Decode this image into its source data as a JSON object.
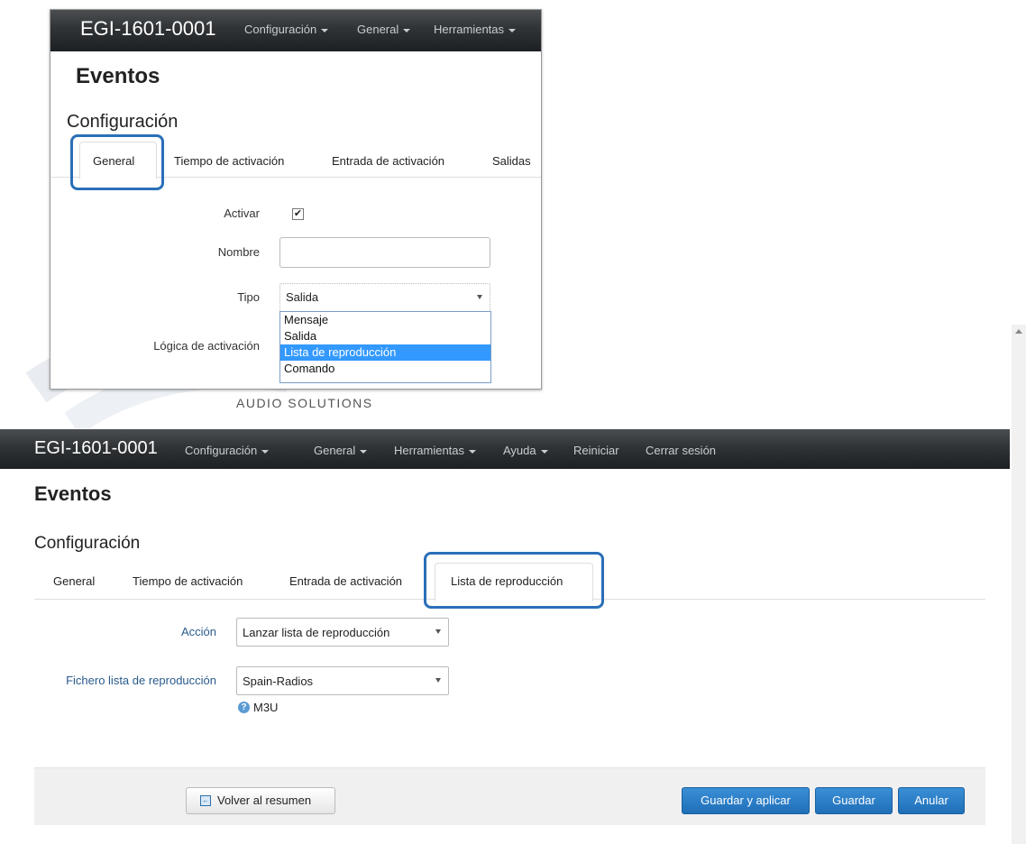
{
  "inset": {
    "brand": "EGI-1601-0001",
    "nav": [
      "Configuración",
      "General",
      "Herramientas"
    ],
    "page_title": "Eventos",
    "section_title": "Configuración",
    "tabs": [
      "General",
      "Tiempo de activación",
      "Entrada de activación",
      "Salidas"
    ],
    "active_tab": "General",
    "form": {
      "activar_label": "Activar",
      "activar_checked": true,
      "nombre_label": "Nombre",
      "nombre_value": "",
      "tipo_label": "Tipo",
      "tipo_value": "Salida",
      "logica_label": "Lógica de activación"
    },
    "dropdown_options": [
      "Mensaje",
      "Salida",
      "Lista de reproducción",
      "Comando"
    ],
    "dropdown_highlighted": "Lista de reproducción"
  },
  "watermark": {
    "text": "AUDIO SOLUTIONS"
  },
  "main": {
    "brand": "EGI-1601-0001",
    "nav": [
      "Configuración",
      "General",
      "Herramientas",
      "Ayuda"
    ],
    "nav_plain": [
      "Reiniciar",
      "Cerrar sesión"
    ],
    "page_title": "Eventos",
    "section_title": "Configuración",
    "tabs": [
      "General",
      "Tiempo de activación",
      "Entrada de activación",
      "Lista de reproducción"
    ],
    "active_tab": "Lista de reproducción",
    "form": {
      "accion_label": "Acción",
      "accion_value": "Lanzar lista de reproducción",
      "fichero_label": "Fichero lista de reproducción",
      "fichero_value": "Spain-Radios",
      "help_text": "M3U"
    },
    "footer": {
      "back_button": "Volver al resumen",
      "save_apply_button": "Guardar y aplicar",
      "save_button": "Guardar",
      "cancel_button": "Anular"
    }
  },
  "colors": {
    "accent": "#2a6fb8",
    "button": "#1f6fb8",
    "label_blue": "#2a5b8c",
    "dropdown_highlight": "#3399ff"
  }
}
